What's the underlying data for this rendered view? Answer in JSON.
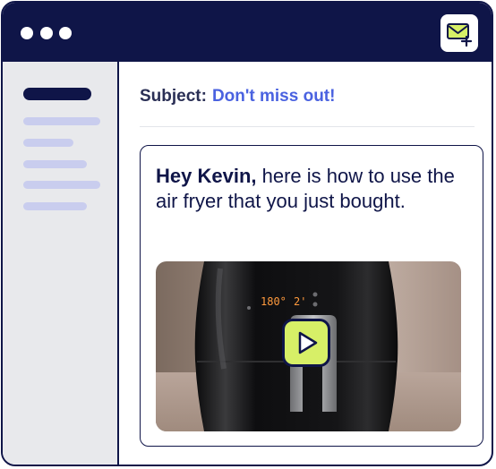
{
  "window": {
    "controls": [
      "dot",
      "dot",
      "dot"
    ]
  },
  "toolbar": {
    "compose_icon": "mail-plus-icon"
  },
  "sidebar": {
    "items": [
      {
        "state": "active"
      },
      {
        "state": "inactive"
      },
      {
        "state": "inactive"
      },
      {
        "state": "inactive"
      },
      {
        "state": "inactive"
      },
      {
        "state": "inactive"
      }
    ]
  },
  "email": {
    "subject_label": "Subject:",
    "subject_value": "Don't miss out!",
    "greeting_name": "Hey Kevin,",
    "greeting_rest": " here is how to use the air fryer that you just bought.",
    "video": {
      "display_temp": "180°",
      "display_time": "2'",
      "play_icon": "play-icon"
    }
  },
  "colors": {
    "navy": "#0f1548",
    "accent_blue": "#4a62e0",
    "lime": "#d7ef67",
    "sidebar_bg": "#e8e9ec",
    "sidebar_bar": "#c9cdee",
    "display_orange": "#ff9a3d"
  }
}
